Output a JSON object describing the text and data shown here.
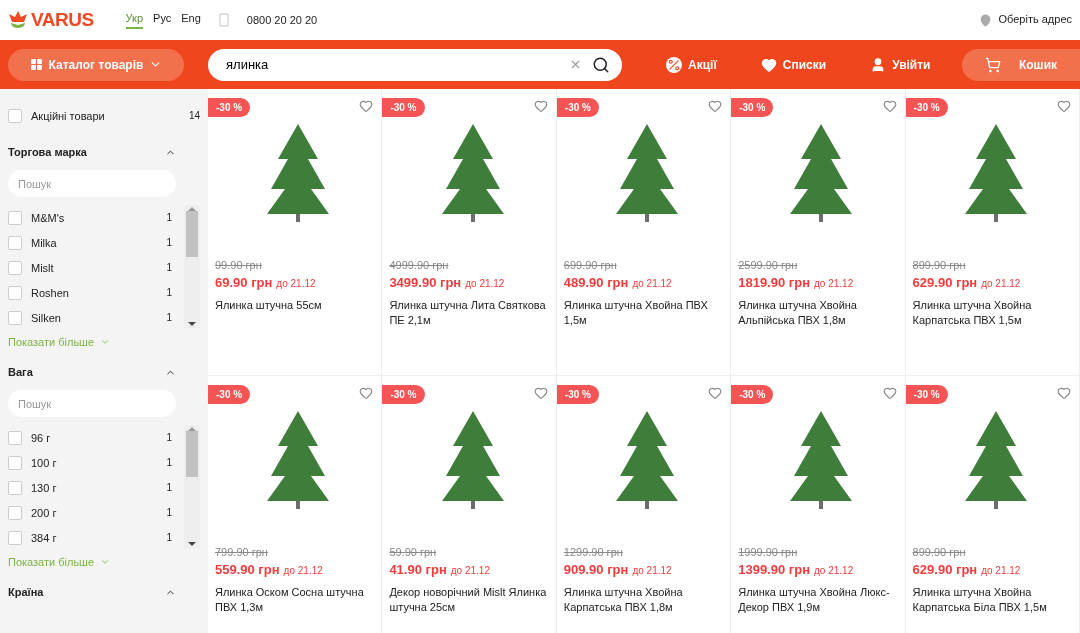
{
  "header": {
    "logo": "VARUS",
    "languages": [
      {
        "label": "Укр",
        "selected": true
      },
      {
        "label": "Рус",
        "selected": false
      },
      {
        "label": "Eng",
        "selected": false
      }
    ],
    "phone": "0800 20 20 20",
    "address": "Оберіть адрес"
  },
  "navbar": {
    "catalog": "Каталог товарів",
    "search": {
      "value": "ялинка"
    },
    "promos": "Акції",
    "lists": "Списки",
    "login": "Увійти",
    "cart": "Кошик"
  },
  "sidebar": {
    "promo_filter": {
      "label": "Акційні товари",
      "count": "14",
      "checked": false
    },
    "filters": [
      {
        "title": "Торгова марка",
        "expanded": true,
        "search": {
          "placeholder": "Пошук"
        },
        "options": [
          {
            "label": "M&M's",
            "count": "1",
            "checked": false
          },
          {
            "label": "Milka",
            "count": "1",
            "checked": false
          },
          {
            "label": "Mislt",
            "count": "1",
            "checked": false
          },
          {
            "label": "Roshen",
            "count": "1",
            "checked": false
          },
          {
            "label": "Silken",
            "count": "1",
            "checked": false
          }
        ],
        "show_more": "Показати більше"
      },
      {
        "title": "Вага",
        "expanded": true,
        "search": {
          "placeholder": "Пошук"
        },
        "options": [
          {
            "label": "96 г",
            "count": "1",
            "checked": false
          },
          {
            "label": "100 г",
            "count": "1",
            "checked": false
          },
          {
            "label": "130 г",
            "count": "1",
            "checked": false
          },
          {
            "label": "200 г",
            "count": "1",
            "checked": false
          },
          {
            "label": "384 г",
            "count": "1",
            "checked": false
          }
        ],
        "show_more": "Показати більше"
      },
      {
        "title": "Країна",
        "expanded": true
      }
    ]
  },
  "products": [
    {
      "badge": "-30 %",
      "old_price": "99.90 грн",
      "price": "69.90 грн",
      "until": "до 21.12",
      "name": "Ялинка штучна 55см"
    },
    {
      "badge": "-30 %",
      "old_price": "4999.90 грн",
      "price": "3499.90 грн",
      "until": "до 21.12",
      "name": "Ялинка штучна Лита Святкова ПЕ 2,1м"
    },
    {
      "badge": "-30 %",
      "old_price": "699.90 грн",
      "price": "489.90 грн",
      "until": "до 21.12",
      "name": "Ялинка штучна Хвойна ПВХ 1,5м"
    },
    {
      "badge": "-30 %",
      "old_price": "2599.90 грн",
      "price": "1819.90 грн",
      "until": "до 21.12",
      "name": "Ялинка штучна Хвойна Альпійська ПВХ 1,8м"
    },
    {
      "badge": "-30 %",
      "old_price": "899.90 грн",
      "price": "629.90 грн",
      "until": "до 21.12",
      "name": "Ялинка штучна Хвойна Карпатська ПВХ 1,5м"
    },
    {
      "badge": "-30 %",
      "old_price": "799.90 грн",
      "price": "559.90 грн",
      "until": "до 21.12",
      "name": "Ялинка Оском Сосна штучна ПВХ 1,3м"
    },
    {
      "badge": "-30 %",
      "old_price": "59.90 грн",
      "price": "41.90 грн",
      "until": "до 21.12",
      "name": "Декор новорічний Mislt Ялинка штучна 25см"
    },
    {
      "badge": "-30 %",
      "old_price": "1299.90 грн",
      "price": "909.90 грн",
      "until": "до 21.12",
      "name": "Ялинка штучна Хвойна Карпатська ПВХ 1,8м"
    },
    {
      "badge": "-30 %",
      "old_price": "1999.90 грн",
      "price": "1399.90 грн",
      "until": "до 21.12",
      "name": "Ялинка штучна Хвойна Люкс-Декор ПВХ 1,9м"
    },
    {
      "badge": "-30 %",
      "old_price": "899.90 грн",
      "price": "629.90 грн",
      "until": "до 21.12",
      "name": "Ялинка штучна Хвойна Карпатська Біла ПВХ 1,5м"
    }
  ]
}
